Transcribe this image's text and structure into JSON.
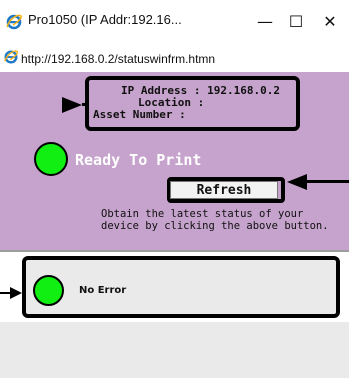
{
  "window": {
    "title": "Pro1050 (IP Addr:192.16...",
    "minimize": "—",
    "maximize": "☐",
    "close": "✕"
  },
  "address": {
    "url": "http://192.168.0.2/statuswinfrm.htmn"
  },
  "device_info": {
    "ip_line": "IP Address : 192.168.0.2",
    "location_line": "Location :",
    "asset_line": "Asset Number :"
  },
  "printer_status": {
    "status_text": "Ready To Print",
    "status_color": "#11ee11",
    "refresh_label": "Refresh",
    "hint_text": "Obtain the latest status of your device by clicking the above button."
  },
  "error_status": {
    "text": "No Error",
    "color": "#11ee11"
  },
  "colors": {
    "panel": "#c6a3cc",
    "status_panel": "#eaeaea",
    "title_text": "#ffffff"
  }
}
